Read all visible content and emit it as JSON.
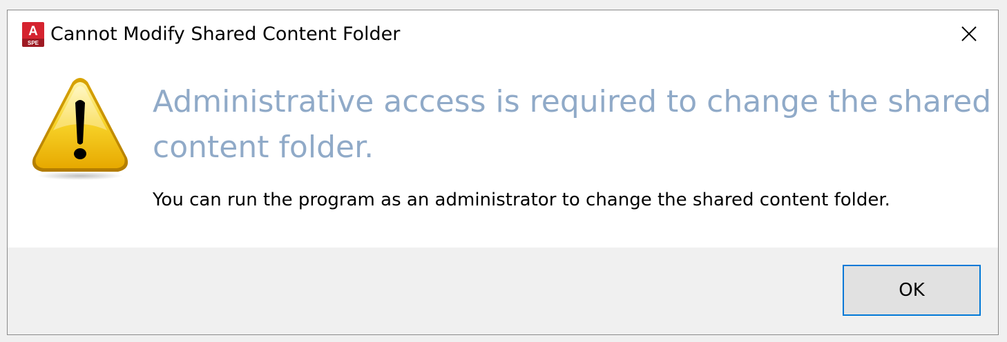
{
  "window": {
    "title": "Cannot Modify Shared Content Folder",
    "app_icon": {
      "name": "autocad-app-icon",
      "letter": "A",
      "badge_text": "SPE",
      "color": "#c8102e"
    },
    "close_icon": "close-icon"
  },
  "message": {
    "icon": "warning-icon",
    "main_instruction": "Administrative access is required to change the shared content folder.",
    "content": "You can run the program as an administrator to change the shared content folder."
  },
  "buttons": {
    "ok_label": "OK"
  },
  "colors": {
    "main_instruction": "#90aac8",
    "focus_border": "#0078d7",
    "footer_bg": "#f0f0f0"
  }
}
